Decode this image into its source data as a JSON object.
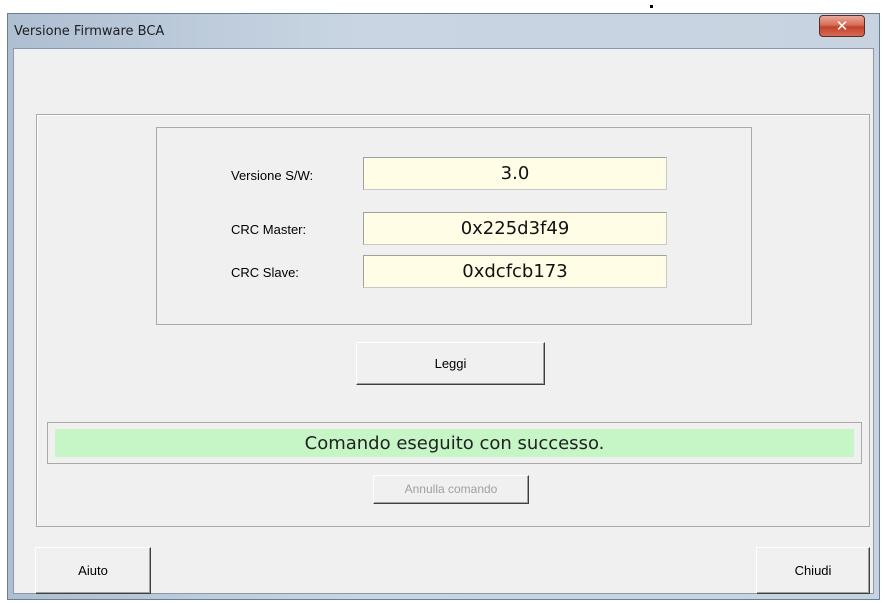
{
  "window": {
    "title": "Versione Firmware BCA",
    "close_label": "✕"
  },
  "fields": {
    "sw_version": {
      "label": "Versione S/W:",
      "value": "3.0"
    },
    "crc_master": {
      "label": "CRC Master:",
      "value": "0x225d3f49"
    },
    "crc_slave": {
      "label": "CRC Slave:",
      "value": "0xdcfcb173"
    }
  },
  "buttons": {
    "read": "Leggi",
    "cancel_command": "Annulla comando",
    "help": "Aiuto",
    "close": "Chiudi"
  },
  "status": {
    "text": "Comando eseguito con successo.",
    "color": "#c6f5c6"
  }
}
